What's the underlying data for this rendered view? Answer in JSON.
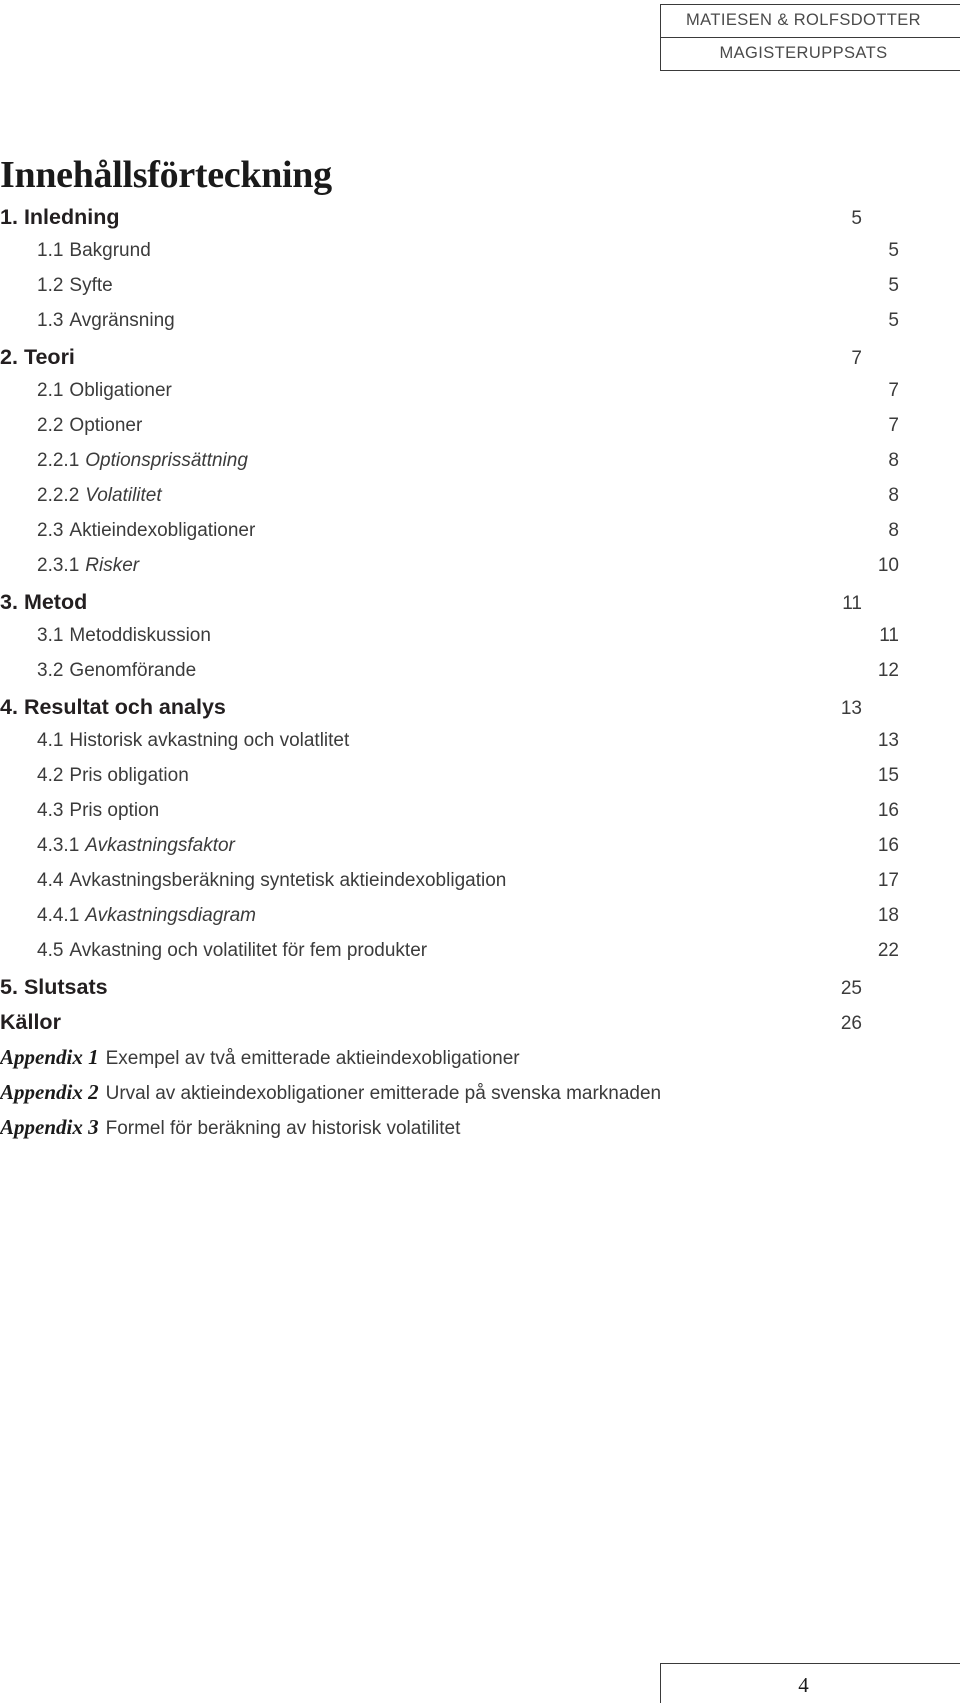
{
  "header": {
    "line1": "MATIESEN & ROLFSDOTTER",
    "line2": "MAGISTERUPPSATS"
  },
  "page_title": "Innehållsförteckning",
  "toc": {
    "entries": [
      {
        "level": 1,
        "num": "1.",
        "text": "Inledning",
        "page": "5"
      },
      {
        "level": 2,
        "num": "1.1",
        "text": "Bakgrund",
        "page": "5"
      },
      {
        "level": 2,
        "num": "1.2",
        "text": "Syfte",
        "page": "5"
      },
      {
        "level": 2,
        "num": "1.3",
        "text": "Avgränsning",
        "page": "5"
      },
      {
        "level": 1,
        "num": "2.",
        "text": "Teori",
        "page": "7"
      },
      {
        "level": 2,
        "num": "2.1",
        "text": "Obligationer",
        "page": "7"
      },
      {
        "level": 2,
        "num": "2.2",
        "text": "Optioner",
        "page": "7"
      },
      {
        "level": 3,
        "num": "2.2.1",
        "text": "Optionsprissättning",
        "page": "8"
      },
      {
        "level": 3,
        "num": "2.2.2",
        "text": "Volatilitet",
        "page": "8"
      },
      {
        "level": 2,
        "num": "2.3",
        "text": "Aktieindexobligationer",
        "page": "8"
      },
      {
        "level": 3,
        "num": "2.3.1",
        "text": "Risker",
        "page": "10"
      },
      {
        "level": 1,
        "num": "3.",
        "text": "Metod",
        "page": "11"
      },
      {
        "level": 2,
        "num": "3.1",
        "text": "Metoddiskussion",
        "page": "11"
      },
      {
        "level": 2,
        "num": "3.2",
        "text": "Genomförande",
        "page": "12"
      },
      {
        "level": 1,
        "num": "4.",
        "text": "Resultat och analys",
        "page": "13"
      },
      {
        "level": 2,
        "num": "4.1",
        "text": "Historisk avkastning och volatlitet",
        "page": "13"
      },
      {
        "level": 2,
        "num": "4.2",
        "text": "Pris obligation",
        "page": "15"
      },
      {
        "level": 2,
        "num": "4.3",
        "text": "Pris option",
        "page": "16"
      },
      {
        "level": 3,
        "num": "4.3.1",
        "text": "Avkastningsfaktor",
        "page": "16"
      },
      {
        "level": 2,
        "num": "4.4",
        "text": "Avkastningsberäkning syntetisk aktieindexobligation",
        "page": "17"
      },
      {
        "level": 3,
        "num": "4.4.1",
        "text": "Avkastningsdiagram",
        "page": "18"
      },
      {
        "level": 2,
        "num": "4.5",
        "text": "Avkastning och volatilitet för fem produkter",
        "page": "22"
      },
      {
        "level": 1,
        "num": "5.",
        "text": "Slutsats",
        "page": "25"
      },
      {
        "level": 1,
        "num": "",
        "text": "Källor",
        "page": "26"
      }
    ],
    "appendices": [
      {
        "tag": "Appendix 1",
        "desc": "Exempel av två emitterade aktieindexobligationer"
      },
      {
        "tag": "Appendix 2",
        "desc": "Urval av aktieindexobligationer emitterade på svenska marknaden"
      },
      {
        "tag": "Appendix 3",
        "desc": "Formel för beräkning av historisk volatilitet"
      }
    ]
  },
  "footer": {
    "page_number": "4"
  }
}
